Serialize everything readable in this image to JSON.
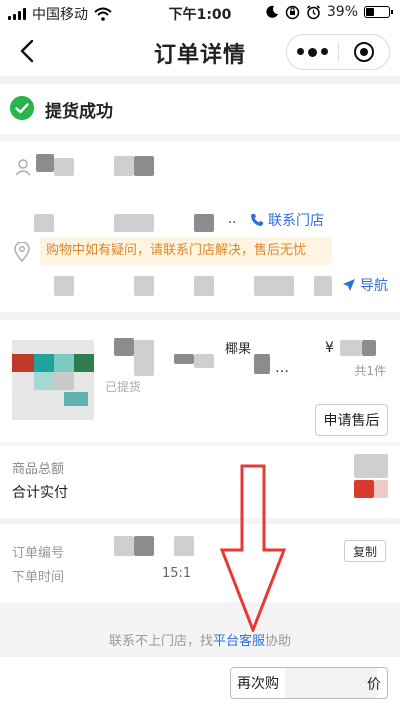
{
  "status_bar": {
    "carrier": "中国移动",
    "time": "下午1:00",
    "battery_percent": "39%",
    "battery_level": 0.39,
    "icons": [
      "signal-icon",
      "wifi-icon",
      "moon-icon",
      "lock-rotation-icon",
      "alarm-icon",
      "battery-icon"
    ]
  },
  "nav": {
    "title": "订单详情",
    "back_icon": "chevron-left-icon",
    "menu_icon": "more-dots-icon",
    "close_icon": "target-circle-icon"
  },
  "order_status": {
    "text": "提货成功",
    "icon": "check-circle-icon",
    "color": "#27b54a"
  },
  "address": {
    "contact_store": "联系门店",
    "notice": "购物中如有疑问，请联系门店解决，售后无忧",
    "navigate": "导航",
    "accent": "#2f6fd6"
  },
  "product": {
    "name_visible": "椰果",
    "price_prefix": "¥",
    "quantity": "共1件",
    "state": "已提货",
    "ellipsis": "…",
    "after_sale_button": "申请售后"
  },
  "totals": {
    "goods_total_label": "商品总额",
    "actual_paid_label": "合计实付"
  },
  "order_info": {
    "order_no_label": "订单编号",
    "order_time_label": "下单时间",
    "order_time_visible": "15:1",
    "copy_button": "复制"
  },
  "footer": {
    "note_before": "联系不上门店，找",
    "note_link": "平台客服",
    "note_after": "协助"
  },
  "bottom": {
    "rebuy_button": "再次购",
    "rebuy_tail": "价"
  },
  "annotation": {
    "color": "#e53935",
    "shape": "down-arrow"
  }
}
